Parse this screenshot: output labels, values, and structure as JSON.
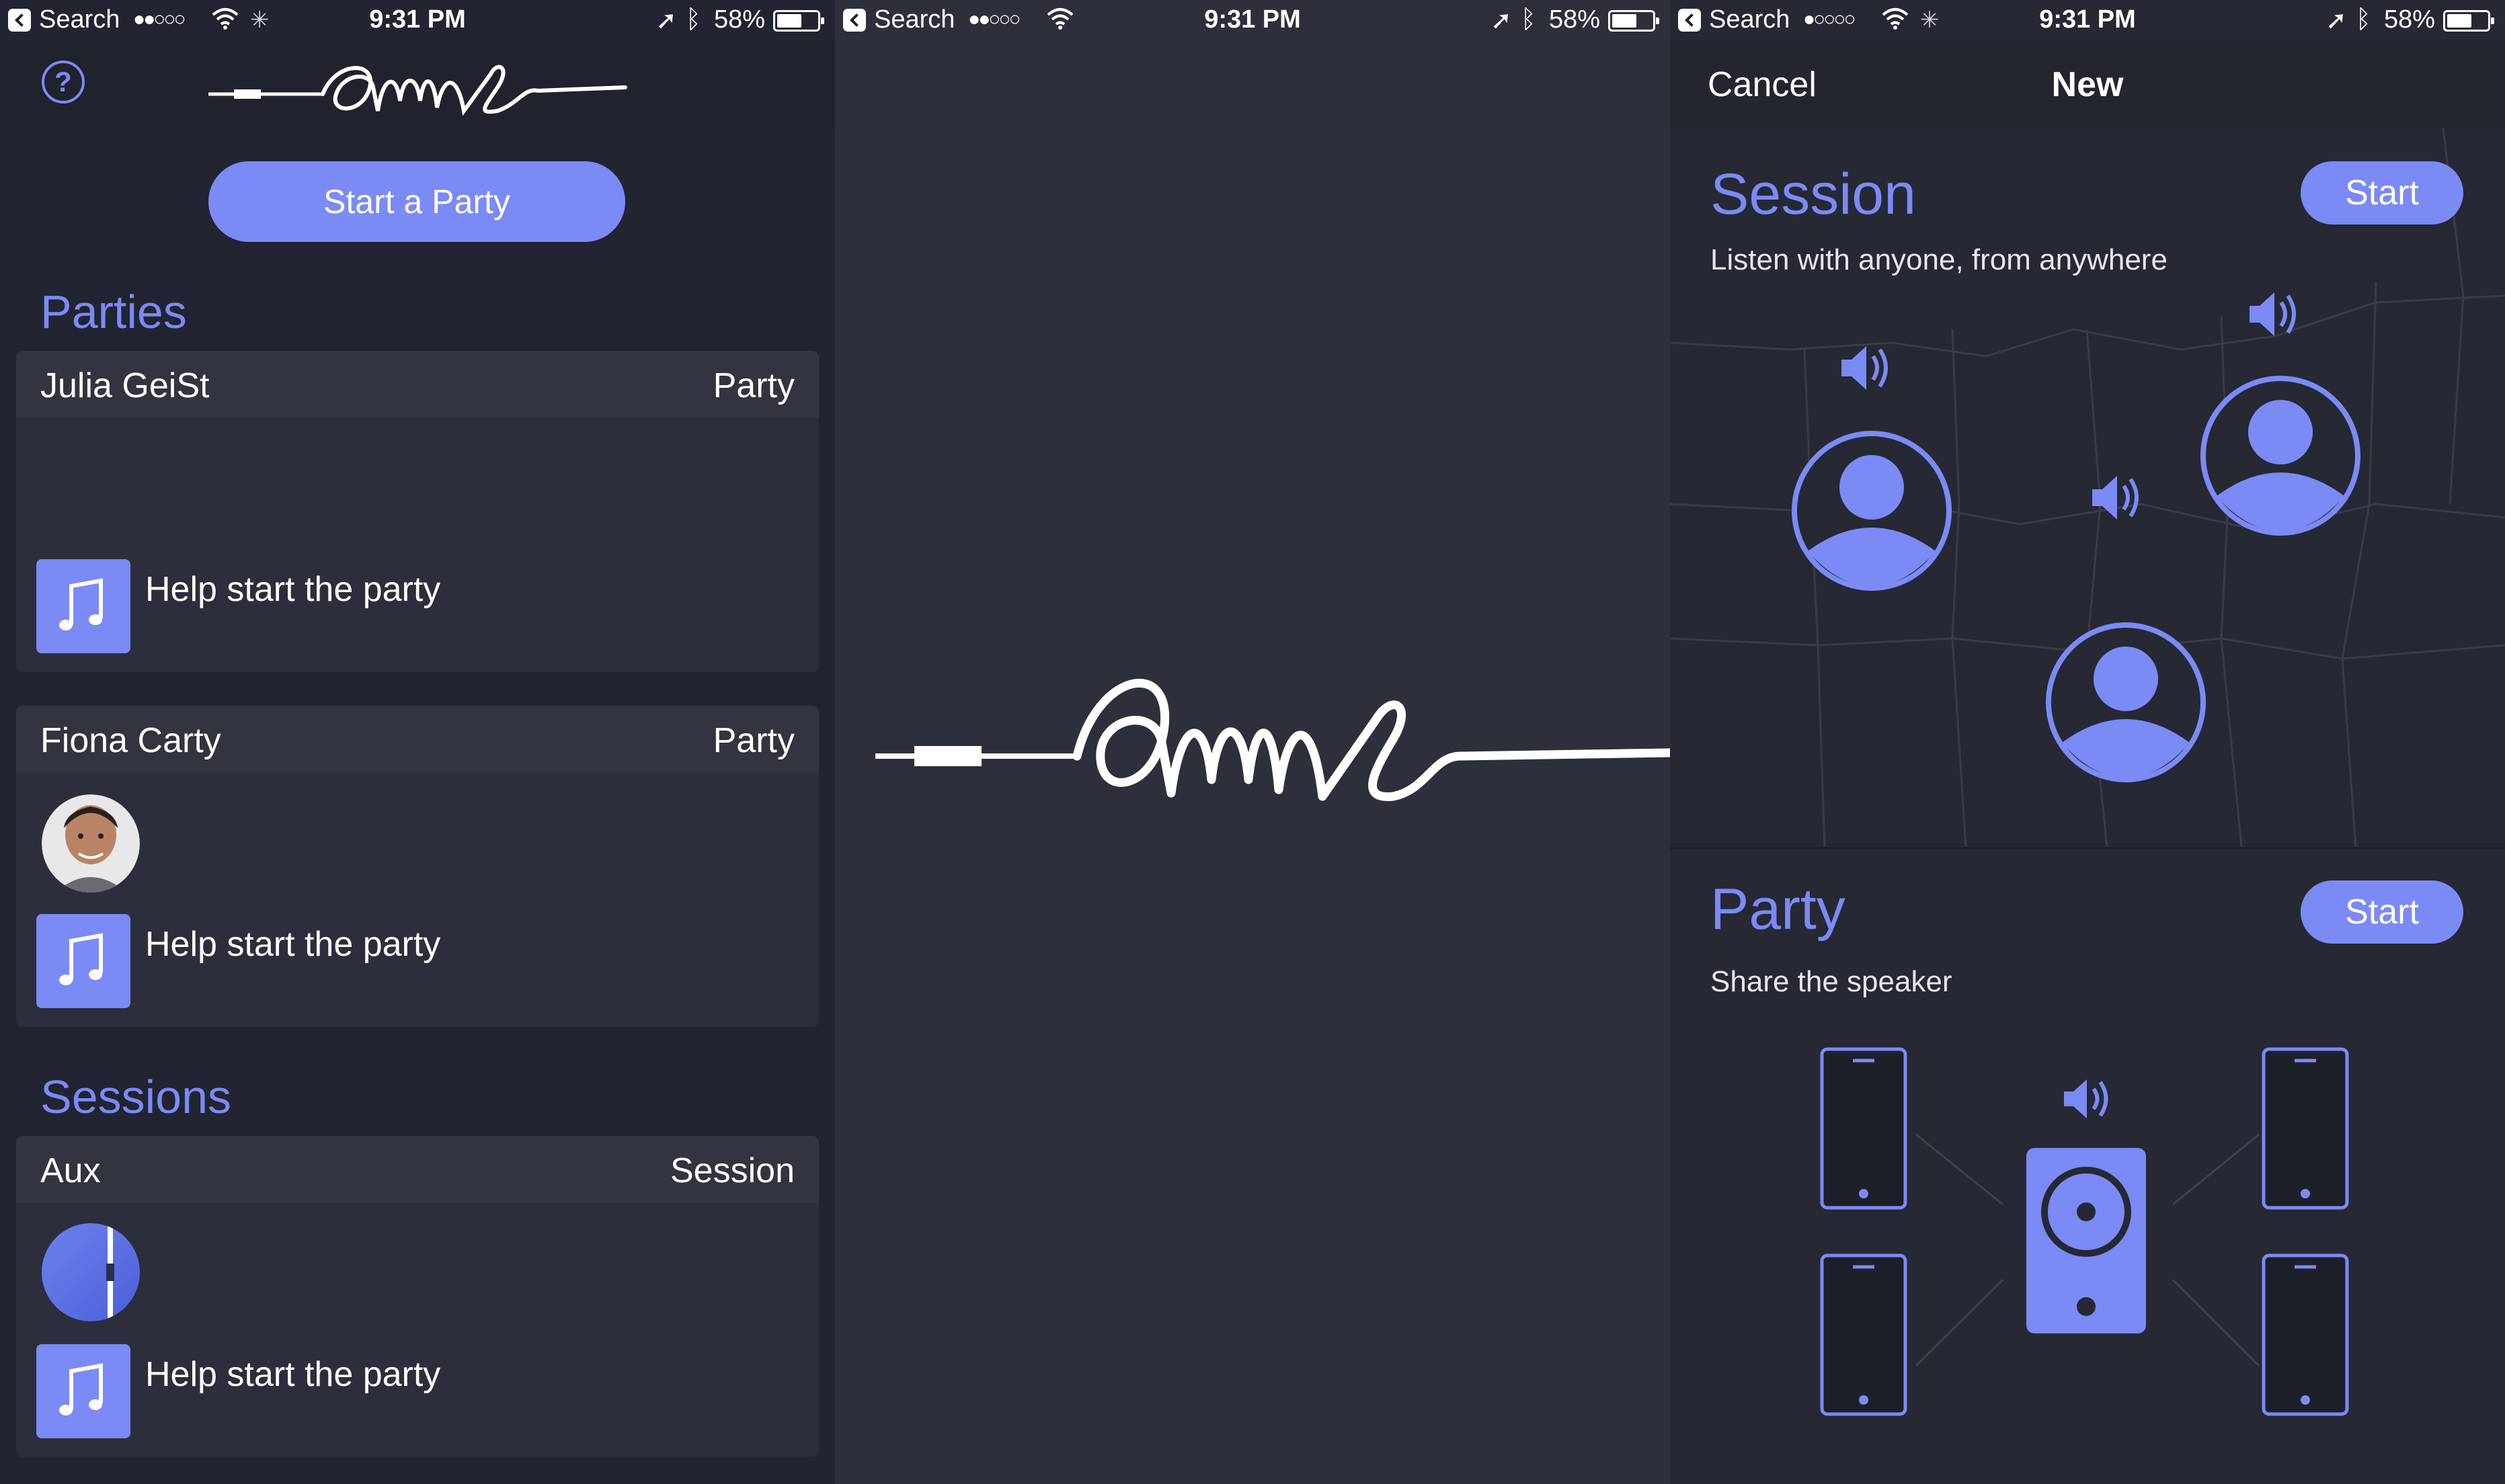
{
  "status_bars": [
    {
      "carrier": "Search",
      "signal": "●●○○○",
      "time": "9:31 PM",
      "battery": "58%"
    },
    {
      "carrier": "Search",
      "signal": "●●○○○",
      "time": "9:31 PM",
      "battery": "58%"
    },
    {
      "carrier": "Search",
      "signal": "●○○○○",
      "time": "9:31 PM",
      "battery": "58%"
    }
  ],
  "home": {
    "help_icon": "question-icon",
    "logo": "aux",
    "start_party_label": "Start a Party",
    "parties_title": "Parties",
    "sessions_title": "Sessions",
    "parties": [
      {
        "name": "Julia GeiSt",
        "type": "Party",
        "help": "Help start the party"
      },
      {
        "name": "Fiona Carty",
        "type": "Party",
        "help": "Help start the party"
      }
    ],
    "sessions": [
      {
        "name": "Aux",
        "type": "Session",
        "help": "Help start the party"
      }
    ]
  },
  "splash": {
    "logo": "aux"
  },
  "new": {
    "cancel_label": "Cancel",
    "title": "New",
    "session": {
      "title": "Session",
      "subtitle": "Listen with anyone, from anywhere",
      "start_label": "Start"
    },
    "party": {
      "title": "Party",
      "subtitle": "Share the speaker",
      "start_label": "Start"
    }
  },
  "colors": {
    "accent": "#7b8af5",
    "background": "#222431",
    "card": "#2c2e3b"
  }
}
